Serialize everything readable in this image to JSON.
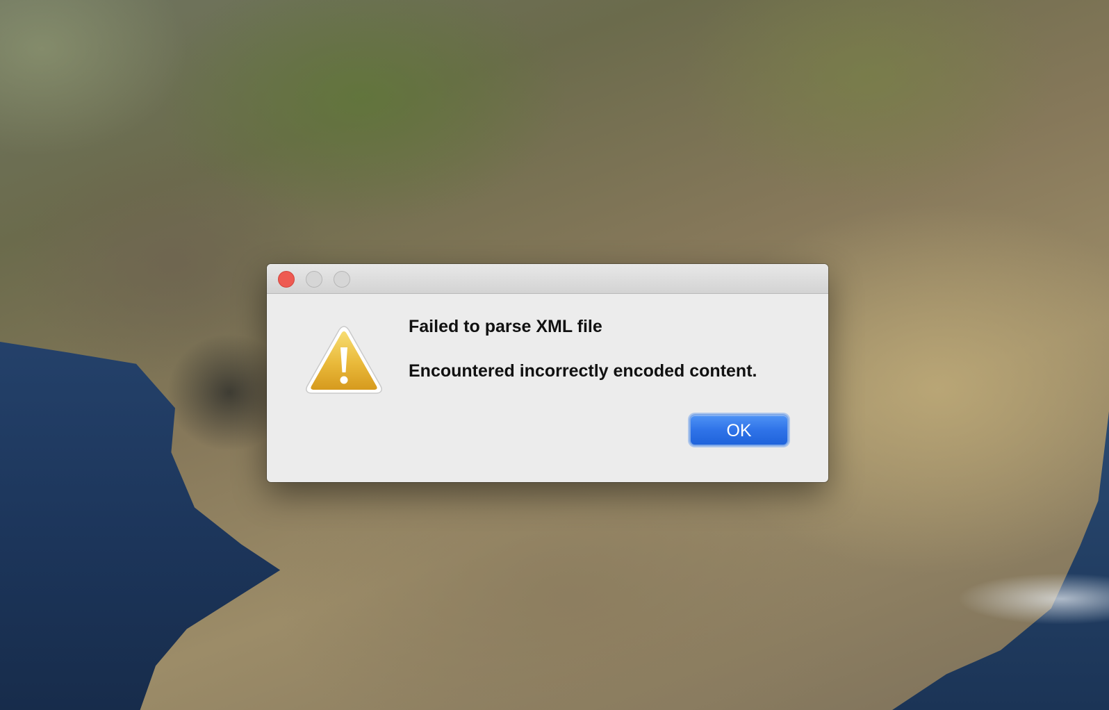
{
  "desktop": {
    "wallpaper": "coastline-landscape"
  },
  "window": {
    "controls": {
      "close_icon": "close-icon",
      "minimize_icon": "minimize-icon",
      "zoom_icon": "zoom-icon"
    }
  },
  "alert": {
    "icon": "warning-icon",
    "title": "Failed to parse XML file",
    "message": "Encountered incorrectly encoded content.",
    "ok_label": "OK"
  },
  "colors": {
    "close": "#ee5a52",
    "button_primary": "#2f73e8",
    "warning": "#e8b73a",
    "dialog_bg": "#ececec"
  }
}
